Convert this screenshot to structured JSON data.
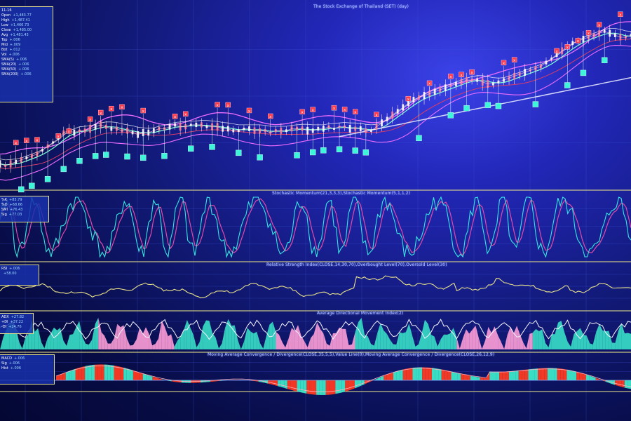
{
  "colors": {
    "price": "#ffd7e0",
    "ma_fast": "#7fffd4",
    "ma_slow": "#ee6cff",
    "ma_long": "#e8eaff",
    "sell_marker": "#ff3c4f",
    "buy_marker": "#3df5d8",
    "stoch_k": "#38e6e0",
    "stoch_d": "#e04ba8",
    "rsi": "#e9e38a",
    "adx_line": "#f4f4ff",
    "adx_pos": "#39e0c8",
    "adx_neg": "#ff9fd8",
    "macd_pos": "#3be8c9",
    "macd_neg": "#ff3b22",
    "panel_border": "#e4e08a",
    "grid": "#3a55d8"
  },
  "panels": {
    "price": {
      "title": "The Stock Exchange of Thailand (SET) (day)"
    },
    "stochastic": {
      "title": "Stochastic Momentum(21,3,3,3),Stochastic Momentum(5,1,1,2)"
    },
    "rsi": {
      "title": "Relative Strength Index(CLOSE,14,30,70),Overbought Level(70),Oversold Level(30)"
    },
    "adx": {
      "title": "Average Directional Movement Index(2)"
    },
    "macd": {
      "title": "Moving Average Convergence / Divergence(CLOSE,35,5,5),Value Line(0),Moving Average Convergence / Divergence(CLOSE,26,12,9)"
    }
  },
  "info_boxes": {
    "price": [
      {
        "label": "11-16",
        "value": ""
      },
      {
        "label": "Open",
        "value": "+1,483.77"
      },
      {
        "label": "High",
        "value": "+1,487.41"
      },
      {
        "label": "Low",
        "value": "+1,466.73"
      },
      {
        "label": "Close",
        "value": "+1,485.00"
      },
      {
        "label": "Avg",
        "value": "+1,481.43"
      },
      {
        "label": "Top",
        "value": "+.006"
      },
      {
        "label": "Mid",
        "value": "+.009"
      },
      {
        "label": "Bot",
        "value": "+.012"
      },
      {
        "label": "Vol",
        "value": "+.006"
      },
      {
        "label": "SMA(5)",
        "value": "+.006"
      },
      {
        "label": "SMA(20)",
        "value": "+.006"
      },
      {
        "label": "SMA(50)",
        "value": "+.006"
      },
      {
        "label": "SMA(200)",
        "value": "+.006"
      }
    ],
    "stochastic": [
      {
        "label": "%K",
        "value": "+83.79"
      },
      {
        "label": "%D",
        "value": "+68.66"
      },
      {
        "label": "SMI",
        "value": "+76.43"
      },
      {
        "label": "Sig",
        "value": "+77.03"
      }
    ],
    "rsi": [
      {
        "label": "RSI",
        "value": "+.006"
      },
      {
        "label": "",
        "value": "+58.00"
      }
    ],
    "adx": [
      {
        "label": "ADX",
        "value": "+27.82"
      },
      {
        "label": "+DI",
        "value": "+37.22"
      },
      {
        "label": "-DI",
        "value": "+24.76"
      }
    ],
    "macd": [
      {
        "label": "MACD",
        "value": "+.006"
      },
      {
        "label": "Sig",
        "value": "+.006"
      },
      {
        "label": "Hist",
        "value": "+.006"
      }
    ]
  },
  "chart_data": {
    "type": "line",
    "title": "The Stock Exchange of Thailand (SET) (day)",
    "x_index_count": 120,
    "series": [
      {
        "name": "SET",
        "values": [
          41,
          40,
          41,
          42,
          43,
          44,
          45,
          46,
          48,
          50,
          52,
          54,
          57,
          58,
          57,
          58,
          58,
          59,
          60,
          61,
          60,
          59,
          59,
          58,
          58,
          57,
          56,
          57,
          57,
          58,
          59,
          59,
          60,
          61,
          60,
          60,
          61,
          61,
          61,
          60,
          60,
          60,
          59,
          59,
          58,
          58,
          59,
          59,
          58,
          58,
          58,
          57,
          58,
          58,
          58,
          59,
          59,
          59,
          58,
          58,
          59,
          59,
          60,
          59,
          60,
          60,
          59,
          59,
          59,
          58,
          58,
          60,
          62,
          64,
          66,
          68,
          70,
          72,
          74,
          75,
          76,
          77,
          78,
          79,
          80,
          81,
          82,
          83,
          84,
          84,
          84,
          83,
          82,
          82,
          83,
          84,
          85,
          86,
          87,
          88,
          89,
          90,
          91,
          93,
          95,
          97,
          99,
          101,
          103,
          104,
          105,
          106,
          107,
          108,
          109,
          108,
          107,
          106,
          106,
          107
        ]
      }
    ],
    "ylim": [
      30,
      115
    ],
    "sell_signals": [
      3,
      5,
      7,
      11,
      13,
      17,
      19,
      21,
      23,
      27,
      33,
      35,
      41,
      43,
      47,
      51,
      57,
      59,
      63,
      65,
      67,
      71,
      77,
      81,
      85,
      87,
      89,
      95,
      97,
      105,
      107,
      109,
      111,
      113,
      117
    ],
    "buy_signals": [
      4,
      6,
      9,
      12,
      15,
      18,
      20,
      24,
      27,
      31,
      36,
      40,
      45,
      49,
      56,
      59,
      61,
      64,
      67,
      69,
      79,
      85,
      88,
      92,
      94,
      101,
      107,
      110,
      114
    ]
  }
}
